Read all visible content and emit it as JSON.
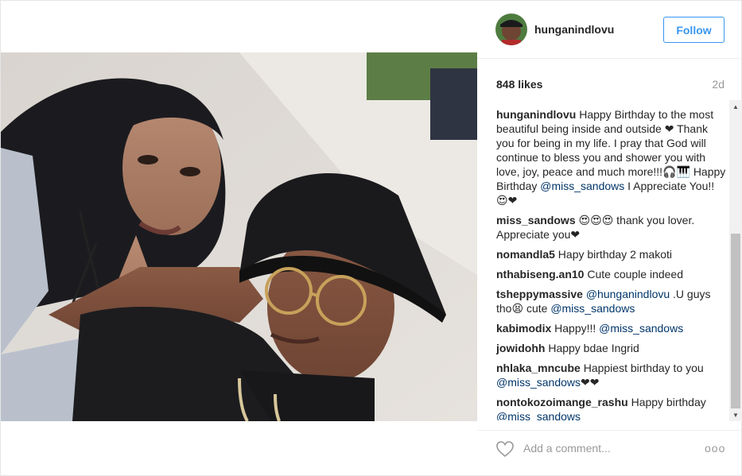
{
  "post": {
    "username": "hunganindlovu",
    "follow_label": "Follow",
    "likes": "848 likes",
    "time": "2d",
    "add_comment_placeholder": "Add a comment...",
    "more_label": "ooo"
  },
  "comments": [
    {
      "user": "hunganindlovu",
      "parts": [
        {
          "t": "text",
          "v": " Happy Birthday to the most beautiful being inside and outside ❤ Thank you for being in my life. I pray that God will continue to bless you and shower you with love, joy, peace and much more!!!🎧🎹 Happy Birthday "
        },
        {
          "t": "mention",
          "v": "@miss_sandows"
        },
        {
          "t": "text",
          "v": " I Appreciate You!! 😍❤"
        }
      ]
    },
    {
      "user": "miss_sandows",
      "parts": [
        {
          "t": "text",
          "v": " 😍😍😍 thank you lover. Appreciate you❤"
        }
      ]
    },
    {
      "user": "nomandla5",
      "parts": [
        {
          "t": "text",
          "v": " Hapy birthday 2 makoti"
        }
      ]
    },
    {
      "user": "nthabiseng.an10",
      "parts": [
        {
          "t": "text",
          "v": " Cute couple indeed"
        }
      ]
    },
    {
      "user": "tsheppymassive",
      "parts": [
        {
          "t": "mention",
          "v": " @hunganindlovu"
        },
        {
          "t": "text",
          "v": " .U guys tho😫 cute "
        },
        {
          "t": "mention",
          "v": "@miss_sandows"
        }
      ]
    },
    {
      "user": "kabimodix",
      "parts": [
        {
          "t": "text",
          "v": " Happy!!! "
        },
        {
          "t": "mention",
          "v": "@miss_sandows"
        }
      ]
    },
    {
      "user": "jowidohh",
      "parts": [
        {
          "t": "text",
          "v": " Happy bdae Ingrid"
        }
      ]
    },
    {
      "user": "nhlaka_mncube",
      "parts": [
        {
          "t": "text",
          "v": " Happiest birthday to you "
        },
        {
          "t": "mention",
          "v": "@miss_sandows"
        },
        {
          "t": "text",
          "v": "❤❤"
        }
      ]
    },
    {
      "user": "nontokozoimange_rashu",
      "parts": [
        {
          "t": "text",
          "v": " Happy birthday "
        },
        {
          "t": "mention",
          "v": "@miss_sandows"
        }
      ]
    }
  ],
  "colors": {
    "accent": "#3897f0",
    "mention": "#003569",
    "muted": "#999999",
    "text": "#262626"
  },
  "icons": {
    "like": "heart-outline-icon",
    "avatar": "avatar"
  }
}
